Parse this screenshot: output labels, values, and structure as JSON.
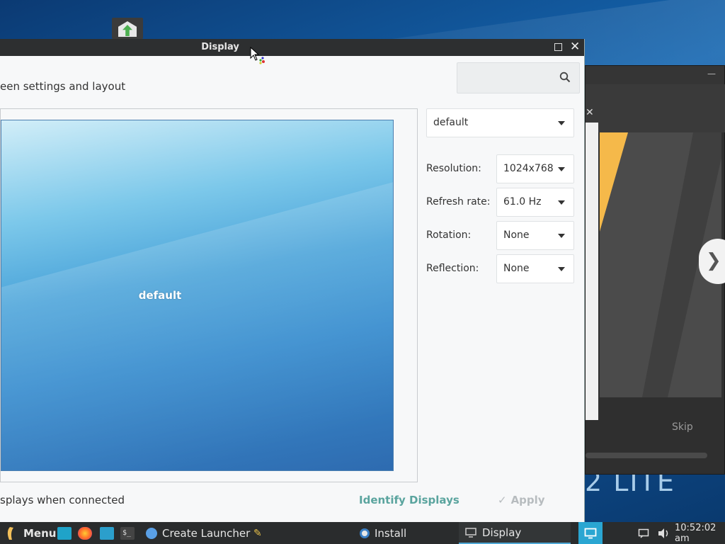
{
  "display_window": {
    "title": "Display",
    "subtitle": "een settings and layout",
    "search_placeholder": "",
    "preview_output_label": "default",
    "profile_value": "default",
    "settings": [
      {
        "label": "Resolution:",
        "value": "1024x768"
      },
      {
        "label": "Refresh rate:",
        "value": "61.0 Hz"
      },
      {
        "label": "Rotation:",
        "value": "None"
      },
      {
        "label": "Reflection:",
        "value": "None"
      }
    ],
    "mirror_option_text": "splays when connected",
    "identify_label": "Identify Displays",
    "apply_label": "Apply"
  },
  "background_window": {
    "skip_label": "Skip"
  },
  "desktop": {
    "brand_text": "2 LITE"
  },
  "taskbar": {
    "menu_label": "Menu",
    "tasks": [
      {
        "label": "Create Launcher"
      },
      {
        "label": "Install"
      },
      {
        "label": "Display"
      }
    ],
    "clock": "10:52:02 am"
  },
  "colors": {
    "accent": "#5aa49e",
    "titlebar": "#2d2f30",
    "taskbar": "#2a2c2d",
    "active_task_underline": "#4fa8d6"
  }
}
